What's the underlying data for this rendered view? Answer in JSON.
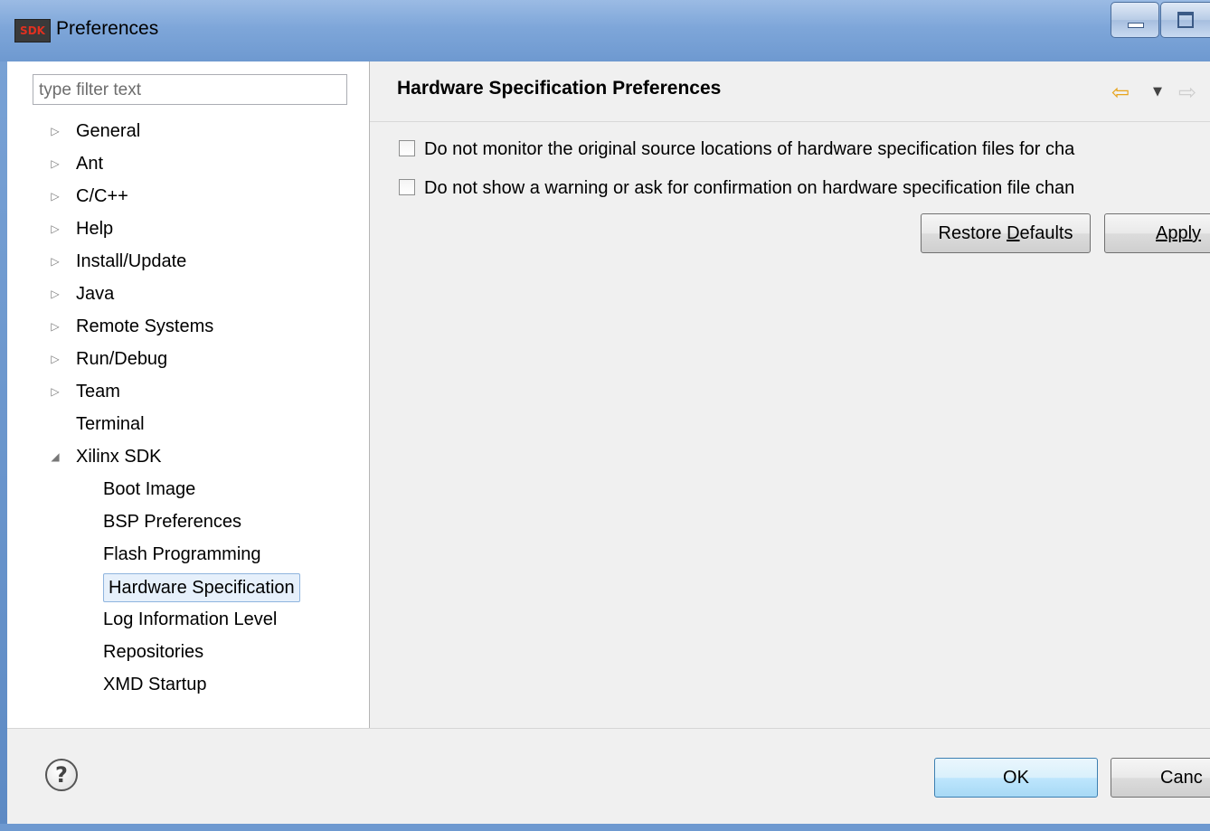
{
  "window": {
    "title": "Preferences",
    "icon_text": "SDK"
  },
  "left": {
    "filter_placeholder": "type filter text",
    "tree": [
      {
        "label": "General",
        "twisty": "▷"
      },
      {
        "label": "Ant",
        "twisty": "▷"
      },
      {
        "label": "C/C++",
        "twisty": "▷"
      },
      {
        "label": "Help",
        "twisty": "▷"
      },
      {
        "label": "Install/Update",
        "twisty": "▷"
      },
      {
        "label": "Java",
        "twisty": "▷"
      },
      {
        "label": "Remote Systems",
        "twisty": "▷"
      },
      {
        "label": "Run/Debug",
        "twisty": "▷"
      },
      {
        "label": "Team",
        "twisty": "▷"
      },
      {
        "label": "Terminal",
        "twisty": ""
      },
      {
        "label": "Xilinx SDK",
        "twisty": "◢"
      },
      {
        "label": "Boot Image"
      },
      {
        "label": "BSP Preferences"
      },
      {
        "label": "Flash Programming"
      },
      {
        "label": "Hardware Specification",
        "selected": true
      },
      {
        "label": "Log Information Level"
      },
      {
        "label": "Repositories"
      },
      {
        "label": "XMD Startup"
      }
    ]
  },
  "right": {
    "title": "Hardware Specification Preferences",
    "nav_back_icon": "⇦",
    "nav_drop_icon": "▼",
    "nav_forward_icon": "⇨",
    "checkboxes": [
      {
        "label": "Do not monitor the original source locations of hardware specification files for cha",
        "checked": false
      },
      {
        "label": "Do not show a warning or ask for confirmation on hardware specification file chan",
        "checked": false
      }
    ],
    "restore_pre": "Restore ",
    "restore_u": "D",
    "restore_post": "efaults",
    "apply_label": "Apply"
  },
  "bottom": {
    "help_icon": "?",
    "ok_label": "OK",
    "cancel_label": "Canc"
  }
}
